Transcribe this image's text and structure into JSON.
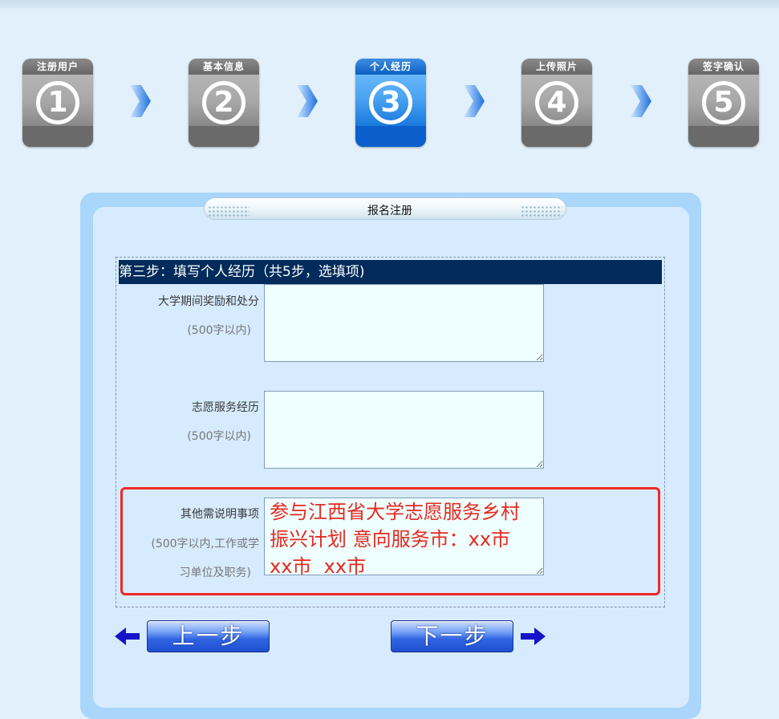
{
  "steps": [
    {
      "label": "注册用户",
      "num": "1"
    },
    {
      "label": "基本信息",
      "num": "2"
    },
    {
      "label": "个人经历",
      "num": "3",
      "active": true
    },
    {
      "label": "上传照片",
      "num": "4"
    },
    {
      "label": "签字确认",
      "num": "5"
    }
  ],
  "panel": {
    "title": "报名注册",
    "header": "第三步：填写个人经历（共5步，选填项)"
  },
  "fields": [
    {
      "label": "大学期间奖励和处分",
      "hint": "(500字以内)",
      "value": ""
    },
    {
      "label": "志愿服务经历",
      "hint": "(500字以内)",
      "value": ""
    },
    {
      "label": "其他需说明事项",
      "hint_line1": "(500字以内,工作或学",
      "hint_line2": "习单位及职务)",
      "value": "参与江西省大学志愿服务乡村振兴计划 意向服务市：xx市  xx市  xx市"
    }
  ],
  "nav": {
    "prev_label": "上一步",
    "next_label": "下一步"
  },
  "colors": {
    "page_bg": "#e1f0fb",
    "header_bg": "#002b5a",
    "highlight": "#ee2a22",
    "active_step": "#1f7ee0"
  }
}
